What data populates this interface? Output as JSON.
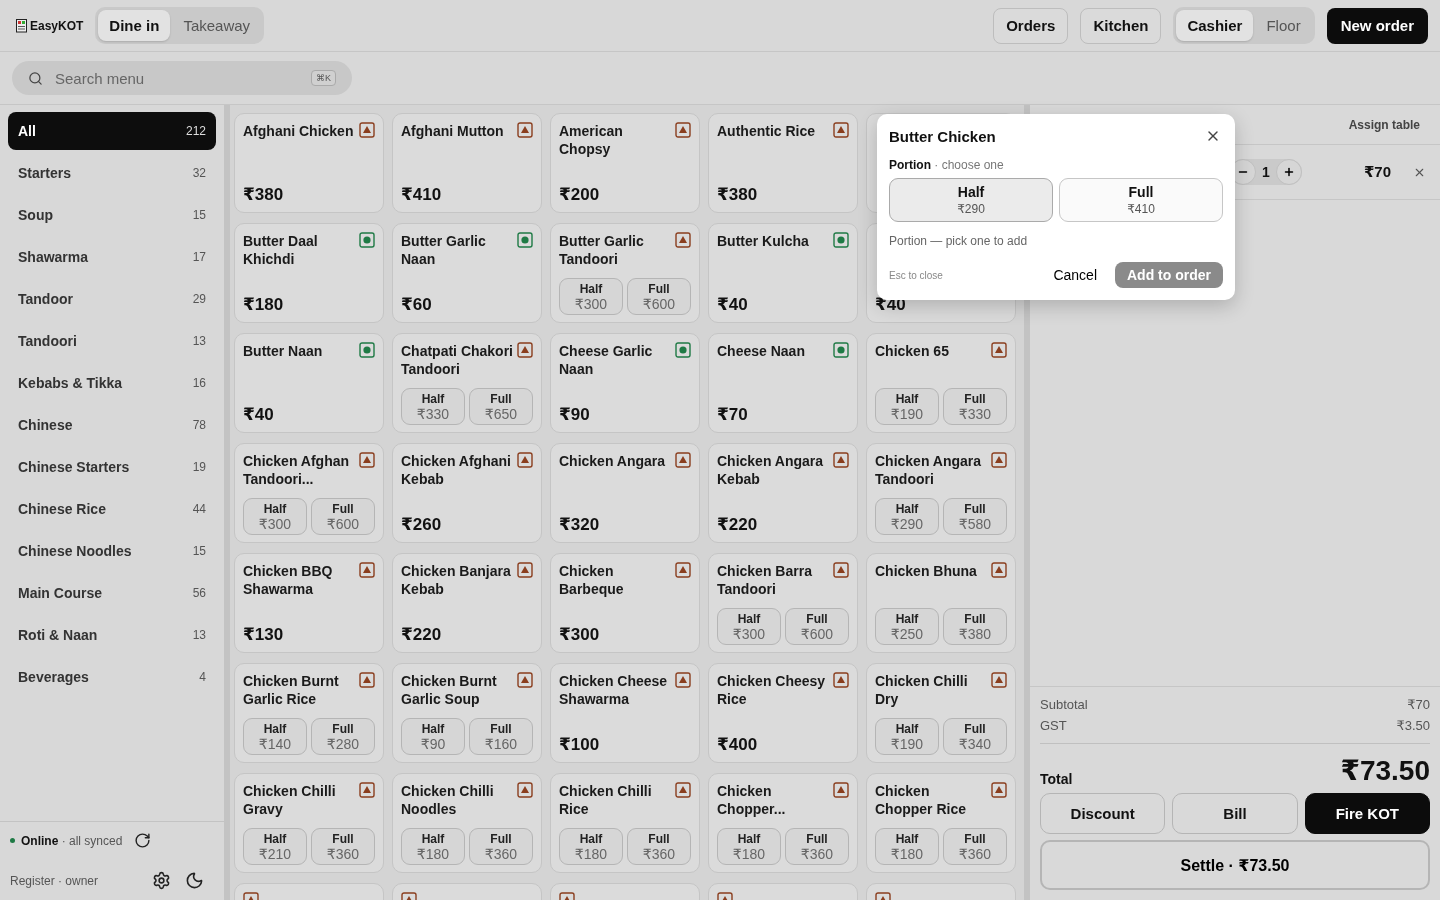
{
  "brand": "EasyKOT",
  "order_modes": [
    {
      "label": "Dine in",
      "selected": true
    },
    {
      "label": "Takeaway",
      "selected": false
    }
  ],
  "top_actions": [
    {
      "label": "Orders",
      "kind": "outline"
    },
    {
      "label": "Kitchen",
      "kind": "outline"
    }
  ],
  "views": [
    {
      "label": "Cashier",
      "selected": true
    },
    {
      "label": "Floor",
      "selected": false
    }
  ],
  "new_order": "New order",
  "search": {
    "placeholder": "Search menu",
    "shortcut": "⌘K"
  },
  "categories": [
    {
      "name": "All",
      "count": "212",
      "selected": true
    },
    {
      "name": "Starters",
      "count": "32",
      "selected": false
    },
    {
      "name": "Soup",
      "count": "15",
      "selected": false
    },
    {
      "name": "Shawarma",
      "count": "17",
      "selected": false
    },
    {
      "name": "Tandoor",
      "count": "29",
      "selected": false
    },
    {
      "name": "Tandoori",
      "count": "13",
      "selected": false
    },
    {
      "name": "Kebabs & Tikka",
      "count": "16",
      "selected": false
    },
    {
      "name": "Chinese",
      "count": "78",
      "selected": false
    },
    {
      "name": "Chinese Starters",
      "count": "19",
      "selected": false
    },
    {
      "name": "Chinese Rice",
      "count": "44",
      "selected": false
    },
    {
      "name": "Chinese Noodles",
      "count": "15",
      "selected": false
    },
    {
      "name": "Main Course",
      "count": "56",
      "selected": false
    },
    {
      "name": "Roti & Naan",
      "count": "13",
      "selected": false
    },
    {
      "name": "Beverages",
      "count": "4",
      "selected": false
    }
  ],
  "status": {
    "online": true,
    "label": "Online",
    "detail": "· all synced"
  },
  "register": "Register · owner",
  "menu_items": [
    {
      "name": "Afghani Chicken",
      "veg": false,
      "price": "₹380"
    },
    {
      "name": "Afghani Mutton",
      "veg": false,
      "price": "₹410"
    },
    {
      "name": "American Chopsy",
      "veg": false,
      "price": "₹200"
    },
    {
      "name": "Authentic Rice",
      "veg": false,
      "price": "₹380"
    },
    {
      "kind": "covered"
    },
    {
      "name": "Butter Daal Khichdi",
      "veg": true,
      "price": "₹180"
    },
    {
      "name": "Butter Garlic Naan",
      "veg": true,
      "price": "₹60"
    },
    {
      "name": "Butter Garlic Tandoori",
      "veg": false,
      "portions": [
        {
          "label": "Half",
          "price": "₹300"
        },
        {
          "label": "Full",
          "price": "₹600"
        }
      ]
    },
    {
      "name": "Butter Kulcha",
      "veg": true,
      "price": "₹40"
    },
    {
      "kind": "covered",
      "price": "₹40"
    },
    {
      "name": "Butter Naan",
      "veg": true,
      "price": "₹40"
    },
    {
      "name": "Chatpati Chakori Tandoori",
      "veg": false,
      "portions": [
        {
          "label": "Half",
          "price": "₹330"
        },
        {
          "label": "Full",
          "price": "₹650"
        }
      ]
    },
    {
      "name": "Cheese Garlic Naan",
      "veg": true,
      "price": "₹90"
    },
    {
      "name": "Cheese Naan",
      "veg": true,
      "price": "₹70"
    },
    {
      "name": "Chicken 65",
      "veg": false,
      "portions": [
        {
          "label": "Half",
          "price": "₹190"
        },
        {
          "label": "Full",
          "price": "₹330"
        }
      ]
    },
    {
      "name": "Chicken Afghan Tandoori...",
      "veg": false,
      "portions": [
        {
          "label": "Half",
          "price": "₹300"
        },
        {
          "label": "Full",
          "price": "₹600"
        }
      ]
    },
    {
      "name": "Chicken Afghani Kebab",
      "veg": false,
      "price": "₹260"
    },
    {
      "name": "Chicken Angara",
      "veg": false,
      "price": "₹320"
    },
    {
      "name": "Chicken Angara Kebab",
      "veg": false,
      "price": "₹220"
    },
    {
      "name": "Chicken Angara Tandoori",
      "veg": false,
      "portions": [
        {
          "label": "Half",
          "price": "₹290"
        },
        {
          "label": "Full",
          "price": "₹580"
        }
      ]
    },
    {
      "name": "Chicken BBQ Shawarma",
      "veg": false,
      "price": "₹130"
    },
    {
      "name": "Chicken Banjara Kebab",
      "veg": false,
      "price": "₹220"
    },
    {
      "name": "Chicken Barbeque",
      "veg": false,
      "price": "₹300"
    },
    {
      "name": "Chicken Barra Tandoori",
      "veg": false,
      "portions": [
        {
          "label": "Half",
          "price": "₹300"
        },
        {
          "label": "Full",
          "price": "₹600"
        }
      ]
    },
    {
      "name": "Chicken Bhuna",
      "veg": false,
      "portions": [
        {
          "label": "Half",
          "price": "₹250"
        },
        {
          "label": "Full",
          "price": "₹380"
        }
      ]
    },
    {
      "name": "Chicken Burnt Garlic Rice",
      "veg": false,
      "portions": [
        {
          "label": "Half",
          "price": "₹140"
        },
        {
          "label": "Full",
          "price": "₹280"
        }
      ]
    },
    {
      "name": "Chicken Burnt Garlic Soup",
      "veg": false,
      "portions": [
        {
          "label": "Half",
          "price": "₹90"
        },
        {
          "label": "Full",
          "price": "₹160"
        }
      ]
    },
    {
      "name": "Chicken Cheese Shawarma",
      "veg": false,
      "price": "₹100"
    },
    {
      "name": "Chicken Cheesy Rice",
      "veg": false,
      "price": "₹400"
    },
    {
      "name": "Chicken Chilli Dry",
      "veg": false,
      "portions": [
        {
          "label": "Half",
          "price": "₹190"
        },
        {
          "label": "Full",
          "price": "₹340"
        }
      ]
    },
    {
      "name": "Chicken Chilli Gravy",
      "veg": false,
      "portions": [
        {
          "label": "Half",
          "price": "₹210"
        },
        {
          "label": "Full",
          "price": "₹360"
        }
      ]
    },
    {
      "name": "Chicken Chilli Noodles",
      "veg": false,
      "portions": [
        {
          "label": "Half",
          "price": "₹180"
        },
        {
          "label": "Full",
          "price": "₹360"
        }
      ]
    },
    {
      "name": "Chicken Chilli Rice",
      "veg": false,
      "portions": [
        {
          "label": "Half",
          "price": "₹180"
        },
        {
          "label": "Full",
          "price": "₹360"
        }
      ]
    },
    {
      "name": "Chicken Chopper...",
      "veg": false,
      "portions": [
        {
          "label": "Half",
          "price": "₹180"
        },
        {
          "label": "Full",
          "price": "₹360"
        }
      ]
    },
    {
      "name": "Chicken Chopper Rice",
      "veg": false,
      "portions": [
        {
          "label": "Half",
          "price": "₹180"
        },
        {
          "label": "Full",
          "price": "₹360"
        }
      ]
    },
    {
      "veg": false
    },
    {
      "veg": false
    },
    {
      "veg": false
    },
    {
      "veg": false
    },
    {
      "veg": false
    }
  ],
  "modal": {
    "title": "Butter Chicken",
    "prompt": "**Portion** · choose one",
    "options": [
      {
        "label": "Half",
        "price": "₹290",
        "selected": true
      },
      {
        "label": "Full",
        "price": "₹410",
        "selected": false
      }
    ],
    "hint": "Portion — pick one to add",
    "esc": "Esc to close",
    "cancel": "Cancel",
    "confirm": {
      "label": "Add to order",
      "disabled": true
    }
  },
  "order": {
    "assign_table": "Assign table",
    "lines": [
      {
        "qty": "1",
        "price": "₹70"
      }
    ],
    "subtotal": {
      "label": "Subtotal",
      "value": "₹70"
    },
    "gst": {
      "label": "GST",
      "value": "₹3.50"
    },
    "total": {
      "label": "Total",
      "value": "₹73.50"
    },
    "actions": [
      {
        "label": "Discount",
        "kind": "outline"
      },
      {
        "label": "Bill",
        "kind": "outline"
      },
      {
        "label": "Fire KOT",
        "kind": "primary"
      }
    ],
    "settle": "Settle ·  ₹73.50"
  }
}
